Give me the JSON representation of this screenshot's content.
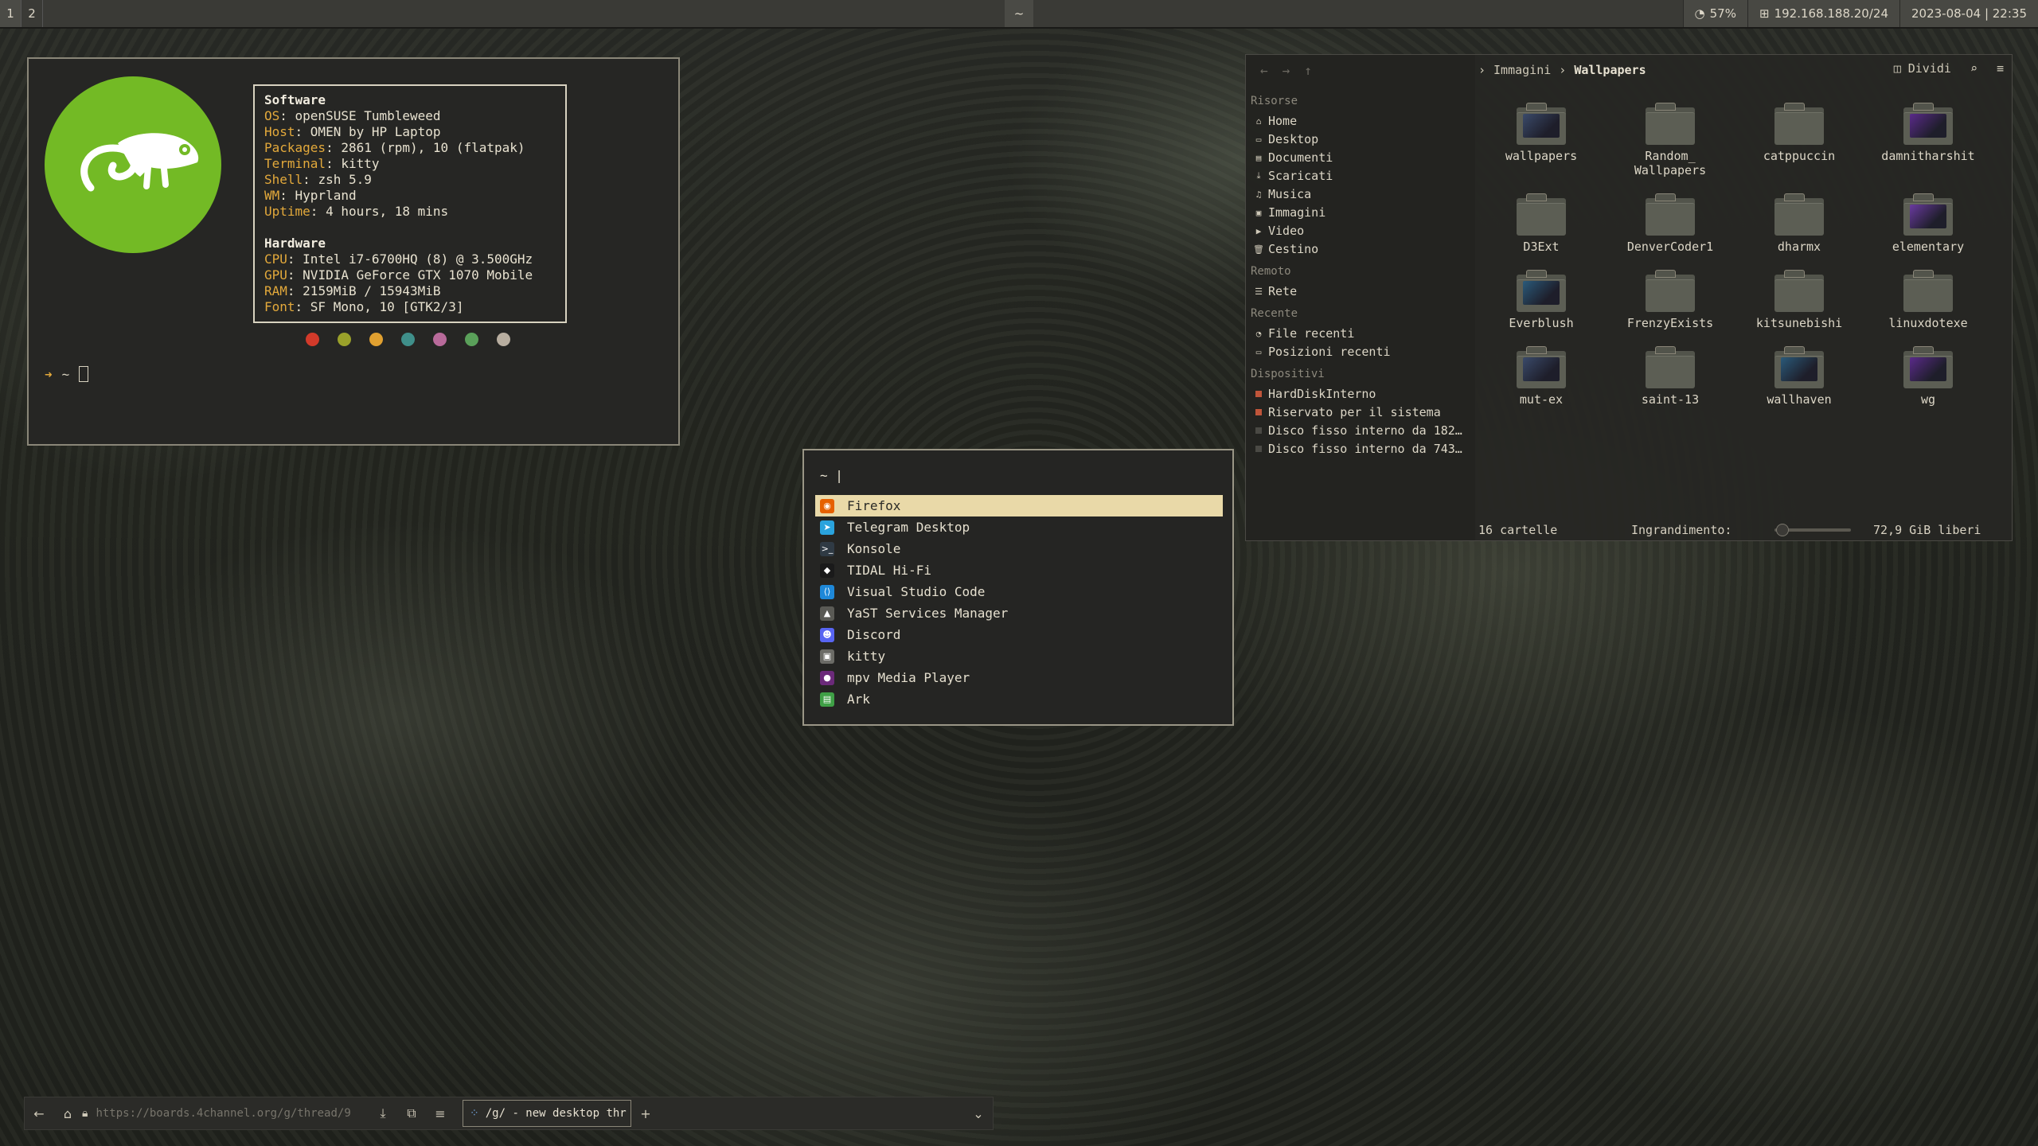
{
  "topbar": {
    "workspaces": [
      "1",
      "2"
    ],
    "center": "~",
    "volume": "57%",
    "ip": "192.168.188.20/24",
    "datetime": "2023-08-04 | 22:35"
  },
  "terminal": {
    "software_header": "Software",
    "software": [
      {
        "k": "OS",
        "v": ": openSUSE Tumbleweed"
      },
      {
        "k": "Host",
        "v": ": OMEN by HP Laptop"
      },
      {
        "k": "Packages",
        "v": ": 2861 (rpm), 10 (flatpak)"
      },
      {
        "k": "Terminal",
        "v": ": kitty"
      },
      {
        "k": "Shell",
        "v": ": zsh 5.9"
      },
      {
        "k": "WM",
        "v": ": Hyprland"
      },
      {
        "k": "Uptime",
        "v": ": 4 hours, 18 mins"
      }
    ],
    "hardware_header": "Hardware",
    "hardware": [
      {
        "k": "CPU",
        "v": ": Intel i7-6700HQ (8) @ 3.500GHz"
      },
      {
        "k": "GPU",
        "v": ": NVIDIA GeForce GTX 1070 Mobile"
      },
      {
        "k": "RAM",
        "v": ": 2159MiB / 15943MiB"
      },
      {
        "k": "Font",
        "v": ": SF Mono, 10 [GTK2/3]"
      }
    ],
    "color_dots": [
      "#d23a2a",
      "#9aa12a",
      "#e0a030",
      "#3f8f8a",
      "#b86a9a",
      "#5aa05a",
      "#b8aea0"
    ],
    "prompt_arrow": "➜",
    "prompt_dir": "~"
  },
  "launcher": {
    "query": "~ |",
    "items": [
      {
        "label": "Firefox",
        "icon": "firefox-icon",
        "color": "#e66000"
      },
      {
        "label": "Telegram Desktop",
        "icon": "telegram-icon",
        "color": "#2aa3dd"
      },
      {
        "label": "Konsole",
        "icon": "konsole-icon",
        "color": "#2f3a44"
      },
      {
        "label": "TIDAL Hi-Fi",
        "icon": "tidal-icon",
        "color": "#1a1a1a"
      },
      {
        "label": "Visual Studio Code",
        "icon": "vscode-icon",
        "color": "#1e88d8"
      },
      {
        "label": "YaST Services Manager",
        "icon": "yast-icon",
        "color": "#5a5a55"
      },
      {
        "label": "Discord",
        "icon": "discord-icon",
        "color": "#5865f2"
      },
      {
        "label": "kitty",
        "icon": "kitty-icon",
        "color": "#6b6b66"
      },
      {
        "label": "mpv Media Player",
        "icon": "mpv-icon",
        "color": "#6b2a7a"
      },
      {
        "label": "Ark",
        "icon": "ark-icon",
        "color": "#3fa046"
      }
    ]
  },
  "filemanager": {
    "breadcrumb": [
      "Immagini",
      "Wallpapers"
    ],
    "split_label": "Dividi",
    "sections": {
      "risorse": "Risorse",
      "remoto": "Remoto",
      "recente": "Recente",
      "dispositivi": "Dispositivi"
    },
    "risorse": [
      "Home",
      "Desktop",
      "Documenti",
      "Scaricati",
      "Musica",
      "Immagini",
      "Video",
      "Cestino"
    ],
    "remoto": [
      "Rete"
    ],
    "recente": [
      "File recenti",
      "Posizioni recenti"
    ],
    "dispositivi": [
      "HardDiskInterno",
      "Riservato per il sistema",
      "Disco fisso interno da 182…",
      "Disco fisso interno da 743…"
    ],
    "folders": [
      {
        "name": "wallpapers",
        "thumb": true
      },
      {
        "name": "Random_\nWallpapers",
        "thumb": false
      },
      {
        "name": "catppuccin",
        "thumb": false
      },
      {
        "name": "damnitharshit",
        "thumb": true
      },
      {
        "name": "D3Ext",
        "thumb": false
      },
      {
        "name": "DenverCoder1",
        "thumb": false
      },
      {
        "name": "dharmx",
        "thumb": false
      },
      {
        "name": "elementary",
        "thumb": true
      },
      {
        "name": "Everblush",
        "thumb": true
      },
      {
        "name": "FrenzyExists",
        "thumb": false
      },
      {
        "name": "kitsunebishi",
        "thumb": false
      },
      {
        "name": "linuxdotexe",
        "thumb": false
      },
      {
        "name": "mut-ex",
        "thumb": true
      },
      {
        "name": "saint-13",
        "thumb": false
      },
      {
        "name": "wallhaven",
        "thumb": true
      },
      {
        "name": "wg",
        "thumb": true
      }
    ],
    "status_count": "16 cartelle",
    "zoom_label": "Ingrandimento:",
    "free_space": "72,9 GiB liberi"
  },
  "browser": {
    "url": "https://boards.4channel.org/g/thread/9",
    "tab_title": "/g/ - new desktop thr"
  }
}
